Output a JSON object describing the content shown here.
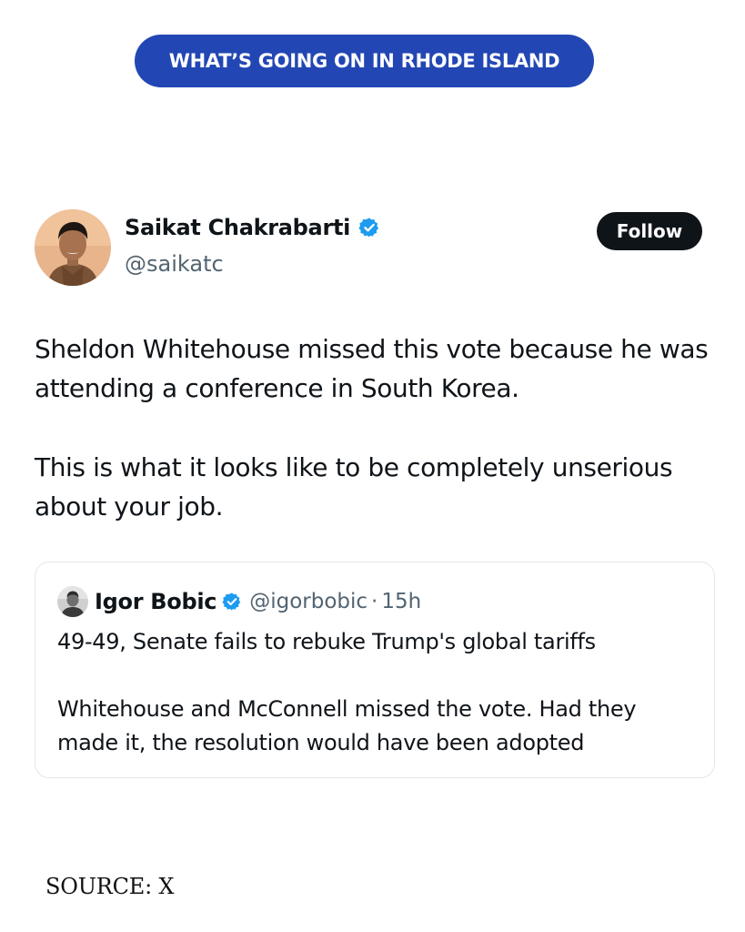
{
  "banner": {
    "title": "WHAT’S GOING ON IN RHODE ISLAND",
    "color": "#2247b4"
  },
  "tweet": {
    "author": {
      "name": "Saikat Chakrabarti",
      "handle": "@saikatc",
      "verified": true,
      "avatar_icon": "user-avatar-photo"
    },
    "follow_label": "Follow",
    "paragraphs": [
      "Sheldon Whitehouse missed this vote because he was attending a conference in South Korea.",
      "This is what it looks like to be completely unserious about your job."
    ]
  },
  "quoted_tweet": {
    "author": {
      "name": "Igor Bobic",
      "handle": "@igorbobic",
      "verified": true
    },
    "separator": "·",
    "time": "15h",
    "paragraphs": [
      "49-49, Senate fails to rebuke Trump's global tariffs",
      "Whitehouse and McConnell missed the vote. Had they made it, the resolution would have been adopted"
    ]
  },
  "footer": {
    "source": "SOURCE: X"
  },
  "colors": {
    "verified_blue": "#1d9bf0",
    "text_primary": "#0f1419",
    "text_secondary": "#536471",
    "follow_button": "#0f1419"
  }
}
